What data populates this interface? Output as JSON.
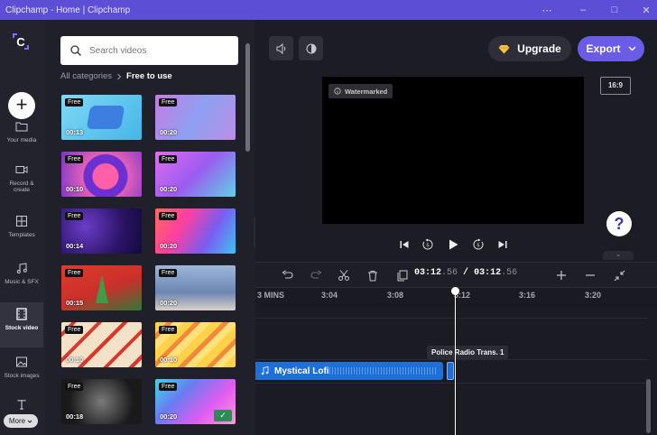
{
  "window": {
    "title": "Clipchamp - Home | Clipchamp",
    "controls": [
      "⋯",
      "–",
      "□",
      "✕"
    ]
  },
  "rail": {
    "items": [
      {
        "label": "Your media",
        "icon": "folder-icon"
      },
      {
        "label": "Record & create",
        "icon": "camera-icon"
      },
      {
        "label": "Templates",
        "icon": "templates-icon"
      },
      {
        "label": "Music & SFX",
        "icon": "music-icon"
      },
      {
        "label": "Stock video",
        "icon": "film-icon",
        "active": true
      },
      {
        "label": "Stock images",
        "icon": "image-icon"
      },
      {
        "label": "",
        "icon": "text-icon"
      }
    ],
    "more_label": "More"
  },
  "panel": {
    "search_placeholder": "Search videos",
    "breadcrumb_root": "All categories",
    "breadcrumb_current": "Free to use",
    "badge": "Free",
    "thumbs": [
      {
        "duration": "00:13"
      },
      {
        "duration": "00:20"
      },
      {
        "duration": "00:10"
      },
      {
        "duration": "00:20"
      },
      {
        "duration": "00:14"
      },
      {
        "duration": "00:20"
      },
      {
        "duration": "00:15"
      },
      {
        "duration": "00:20"
      },
      {
        "duration": "00:10"
      },
      {
        "duration": "00:10"
      },
      {
        "duration": "00:18"
      },
      {
        "duration": "00:20"
      }
    ]
  },
  "header": {
    "upgrade_label": "Upgrade",
    "export_label": "Export"
  },
  "preview": {
    "aspect": "16:9",
    "watermark": "Watermarked"
  },
  "timeline": {
    "current_time": "03:12",
    "current_frac": ".56",
    "separator": "/",
    "total_time": "03:12",
    "total_frac": ".56",
    "ruler": [
      "3 MINS",
      "3:04",
      "3:08",
      "3:12",
      "3:16",
      "3:20"
    ],
    "audio_clip": "Mystical Lofi",
    "tooltip": "Police Radio Trans. 1"
  },
  "colors": {
    "titlebar": "#5b4fd6",
    "accent": "#6a5ce6",
    "audio": "#1f6fd8",
    "free_check": "#2e8b57"
  }
}
